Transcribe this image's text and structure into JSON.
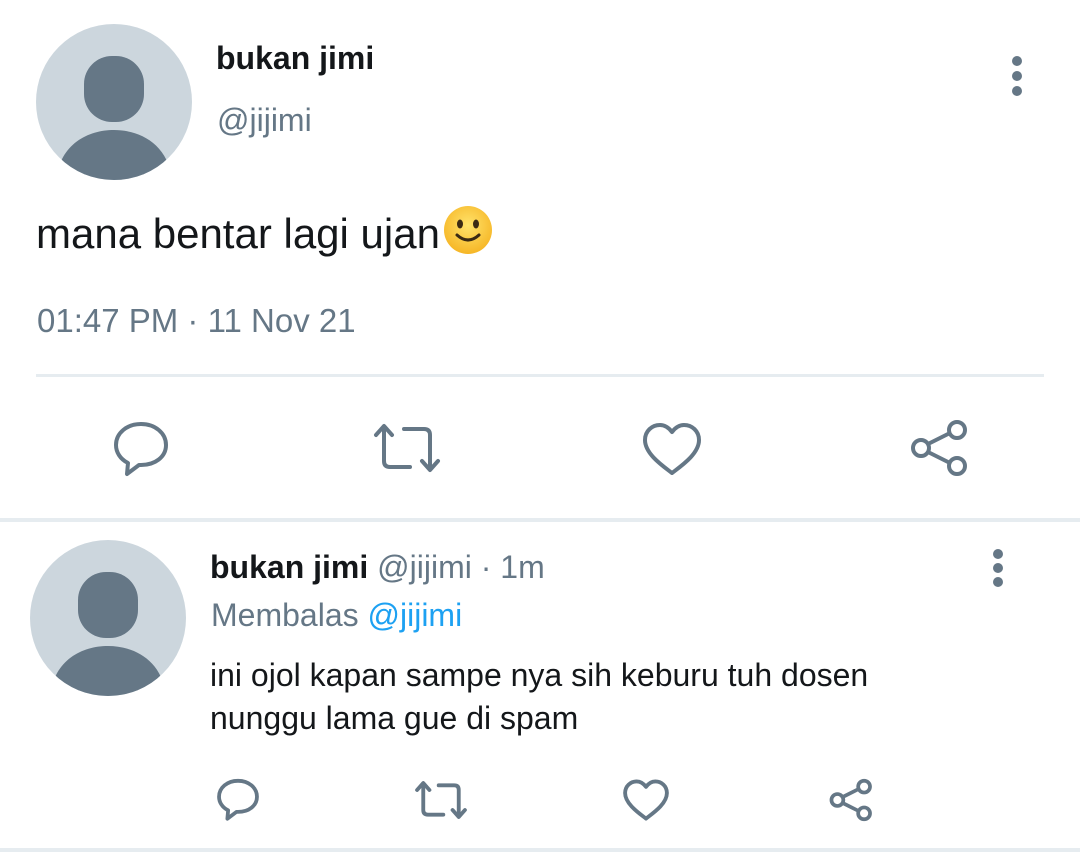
{
  "main_tweet": {
    "author_name": "bukan jimi",
    "author_handle": "@jijimi",
    "text": "mana bentar lagi ujan",
    "emoji": "slightly-smiling-face",
    "time": "01:47 PM",
    "separator": "·",
    "date": "11 Nov 21",
    "actions": [
      "reply-icon",
      "retweet-icon",
      "like-icon",
      "share-icon"
    ]
  },
  "reply": {
    "author_name": "bukan jimi",
    "author_handle": "@jijimi",
    "separator": "·",
    "time_ago": "1m",
    "replying_label": "Membalas",
    "replying_to": "@jijimi",
    "text_lines": [
      "ini ojol kapan sampe nya sih keburu tuh dosen",
      "nunggu lama gue di spam"
    ],
    "actions": [
      "reply-icon",
      "retweet-icon",
      "like-icon",
      "share-icon"
    ]
  },
  "colors": {
    "text": "#14171a",
    "secondary": "#657786",
    "accent": "#1da1f2",
    "avatar_bg": "#ccd6dd",
    "avatar_fg": "#657786",
    "divider": "#e6ecf0"
  }
}
